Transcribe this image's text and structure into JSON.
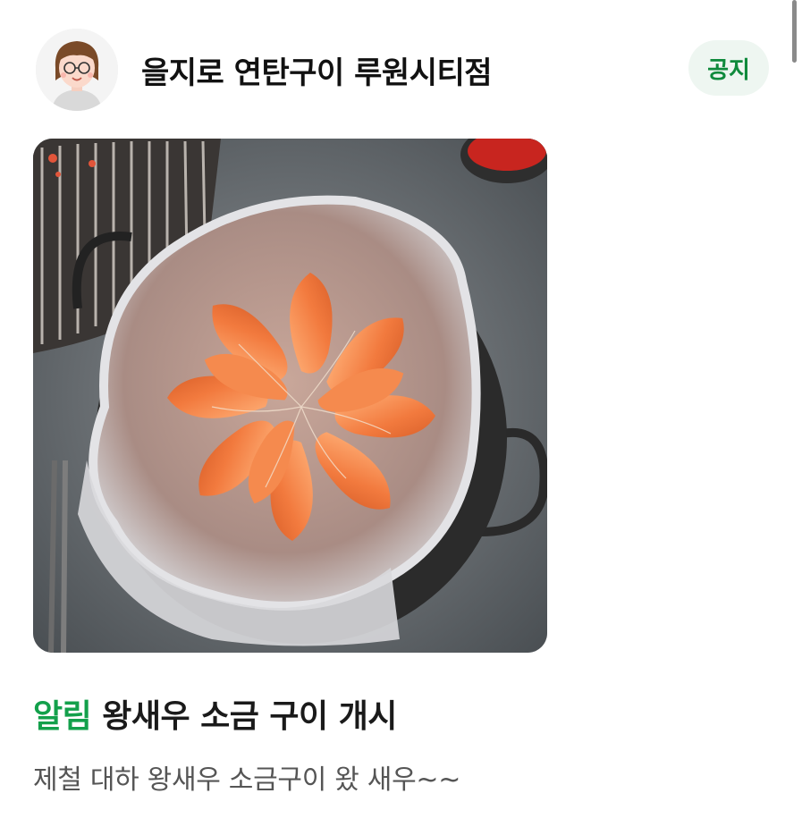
{
  "store": {
    "name": "을지로 연탄구이 루원시티점"
  },
  "badge": {
    "label": "공지"
  },
  "post": {
    "tag": "알림",
    "title": "왕새우 소금 구이 개시",
    "body": "제철 대하 왕새우 소금구이 왔 새우~~"
  },
  "colors": {
    "accent_green": "#13a04b",
    "badge_bg": "#eef6f1",
    "badge_text": "#0f8a3c"
  }
}
